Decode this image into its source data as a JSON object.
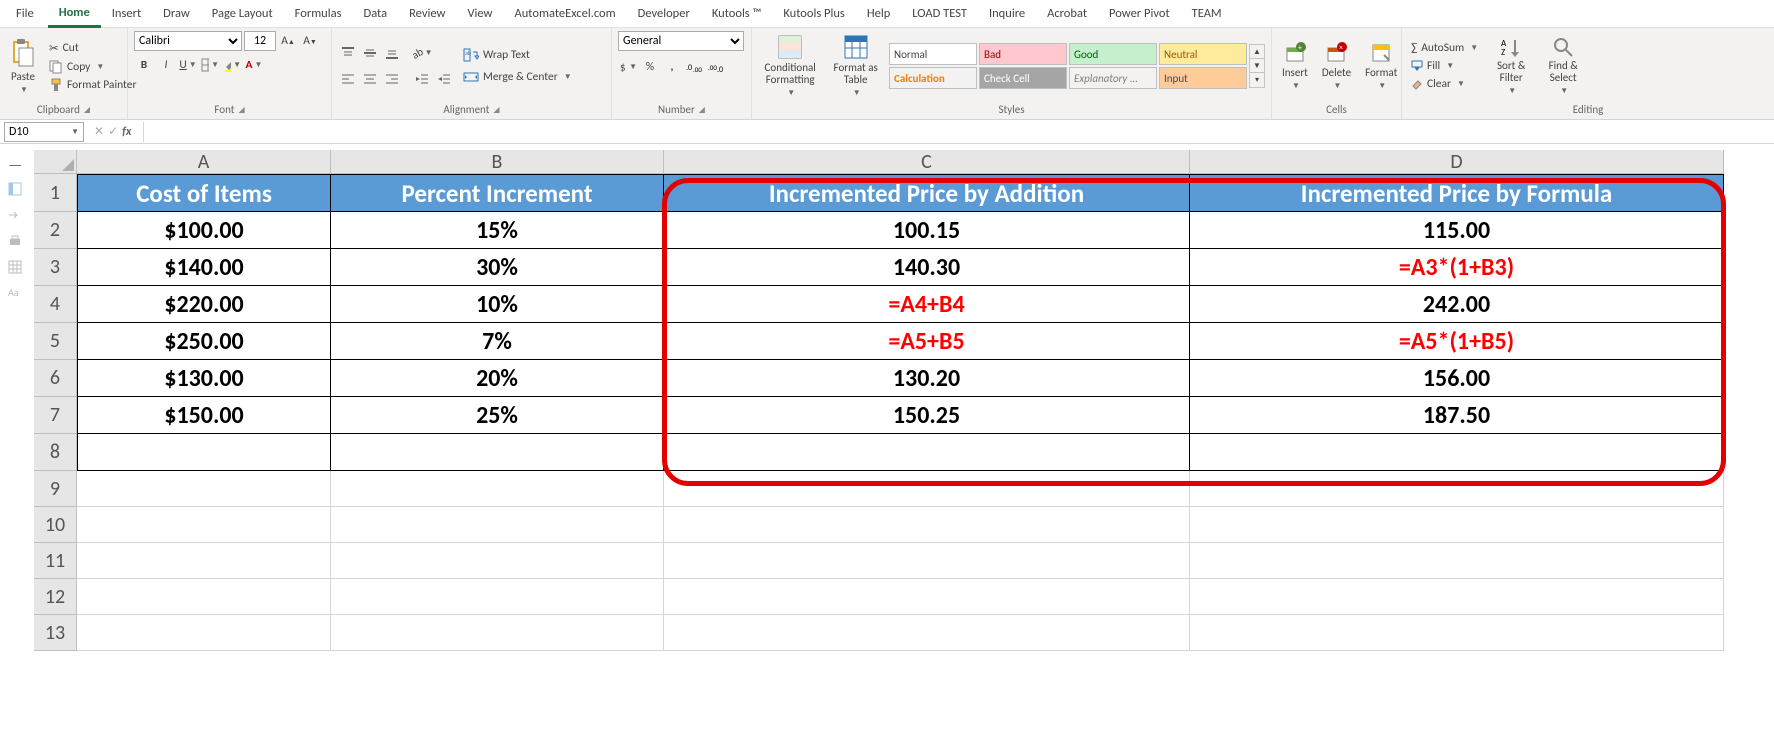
{
  "tabs": [
    "File",
    "Home",
    "Insert",
    "Draw",
    "Page Layout",
    "Formulas",
    "Data",
    "Review",
    "View",
    "AutomateExcel.com",
    "Developer",
    "Kutools ™",
    "Kutools Plus",
    "Help",
    "LOAD TEST",
    "Inquire",
    "Acrobat",
    "Power Pivot",
    "TEAM"
  ],
  "active_tab": "Home",
  "clipboard": {
    "paste": "Paste",
    "cut": "Cut",
    "copy": "Copy",
    "painter": "Format Painter",
    "label": "Clipboard"
  },
  "font": {
    "name": "Calibri",
    "size": "12",
    "label": "Font"
  },
  "alignment": {
    "wrap": "Wrap Text",
    "merge": "Merge & Center",
    "label": "Alignment"
  },
  "number": {
    "format": "General",
    "label": "Number"
  },
  "styles": {
    "cf": "Conditional Formatting",
    "fat": "Format as Table",
    "s": [
      "Normal",
      "Bad",
      "Good",
      "Neutral",
      "Calculation",
      "Check Cell",
      "Explanatory ...",
      "Input"
    ],
    "label": "Styles"
  },
  "cells": {
    "ins": "Insert",
    "del": "Delete",
    "fmt": "Format",
    "label": "Cells"
  },
  "editing": {
    "sum": "AutoSum",
    "fill": "Fill",
    "clear": "Clear",
    "sort": "Sort & Filter",
    "find": "Find & Select",
    "label": "Editing"
  },
  "namebox": "D10",
  "sheet": {
    "cols": [
      "A",
      "B",
      "C",
      "D"
    ],
    "header": [
      "Cost of Items",
      "Percent Increment",
      "Incremented Price by Addition",
      "Incremented Price by Formula"
    ],
    "rows": [
      {
        "n": "2",
        "A": "$100.00",
        "B": "15%",
        "C": "100.15",
        "D": "115.00"
      },
      {
        "n": "3",
        "A": "$140.00",
        "B": "30%",
        "C": "140.30",
        "D": "=A3*(1+B3)",
        "Dred": true
      },
      {
        "n": "4",
        "A": "$220.00",
        "B": "10%",
        "C": "=A4+B4",
        "Cred": true,
        "D": "242.00"
      },
      {
        "n": "5",
        "A": "$250.00",
        "B": "7%",
        "C": "=A5+B5",
        "Cred": true,
        "D": "=A5*(1+B5)",
        "Dred": true
      },
      {
        "n": "6",
        "A": "$130.00",
        "B": "20%",
        "C": "130.20",
        "D": "156.00"
      },
      {
        "n": "7",
        "A": "$150.00",
        "B": "25%",
        "C": "150.25",
        "D": "187.50"
      }
    ],
    "empty_rows": [
      "8",
      "9",
      "10",
      "11",
      "12",
      "13"
    ]
  }
}
